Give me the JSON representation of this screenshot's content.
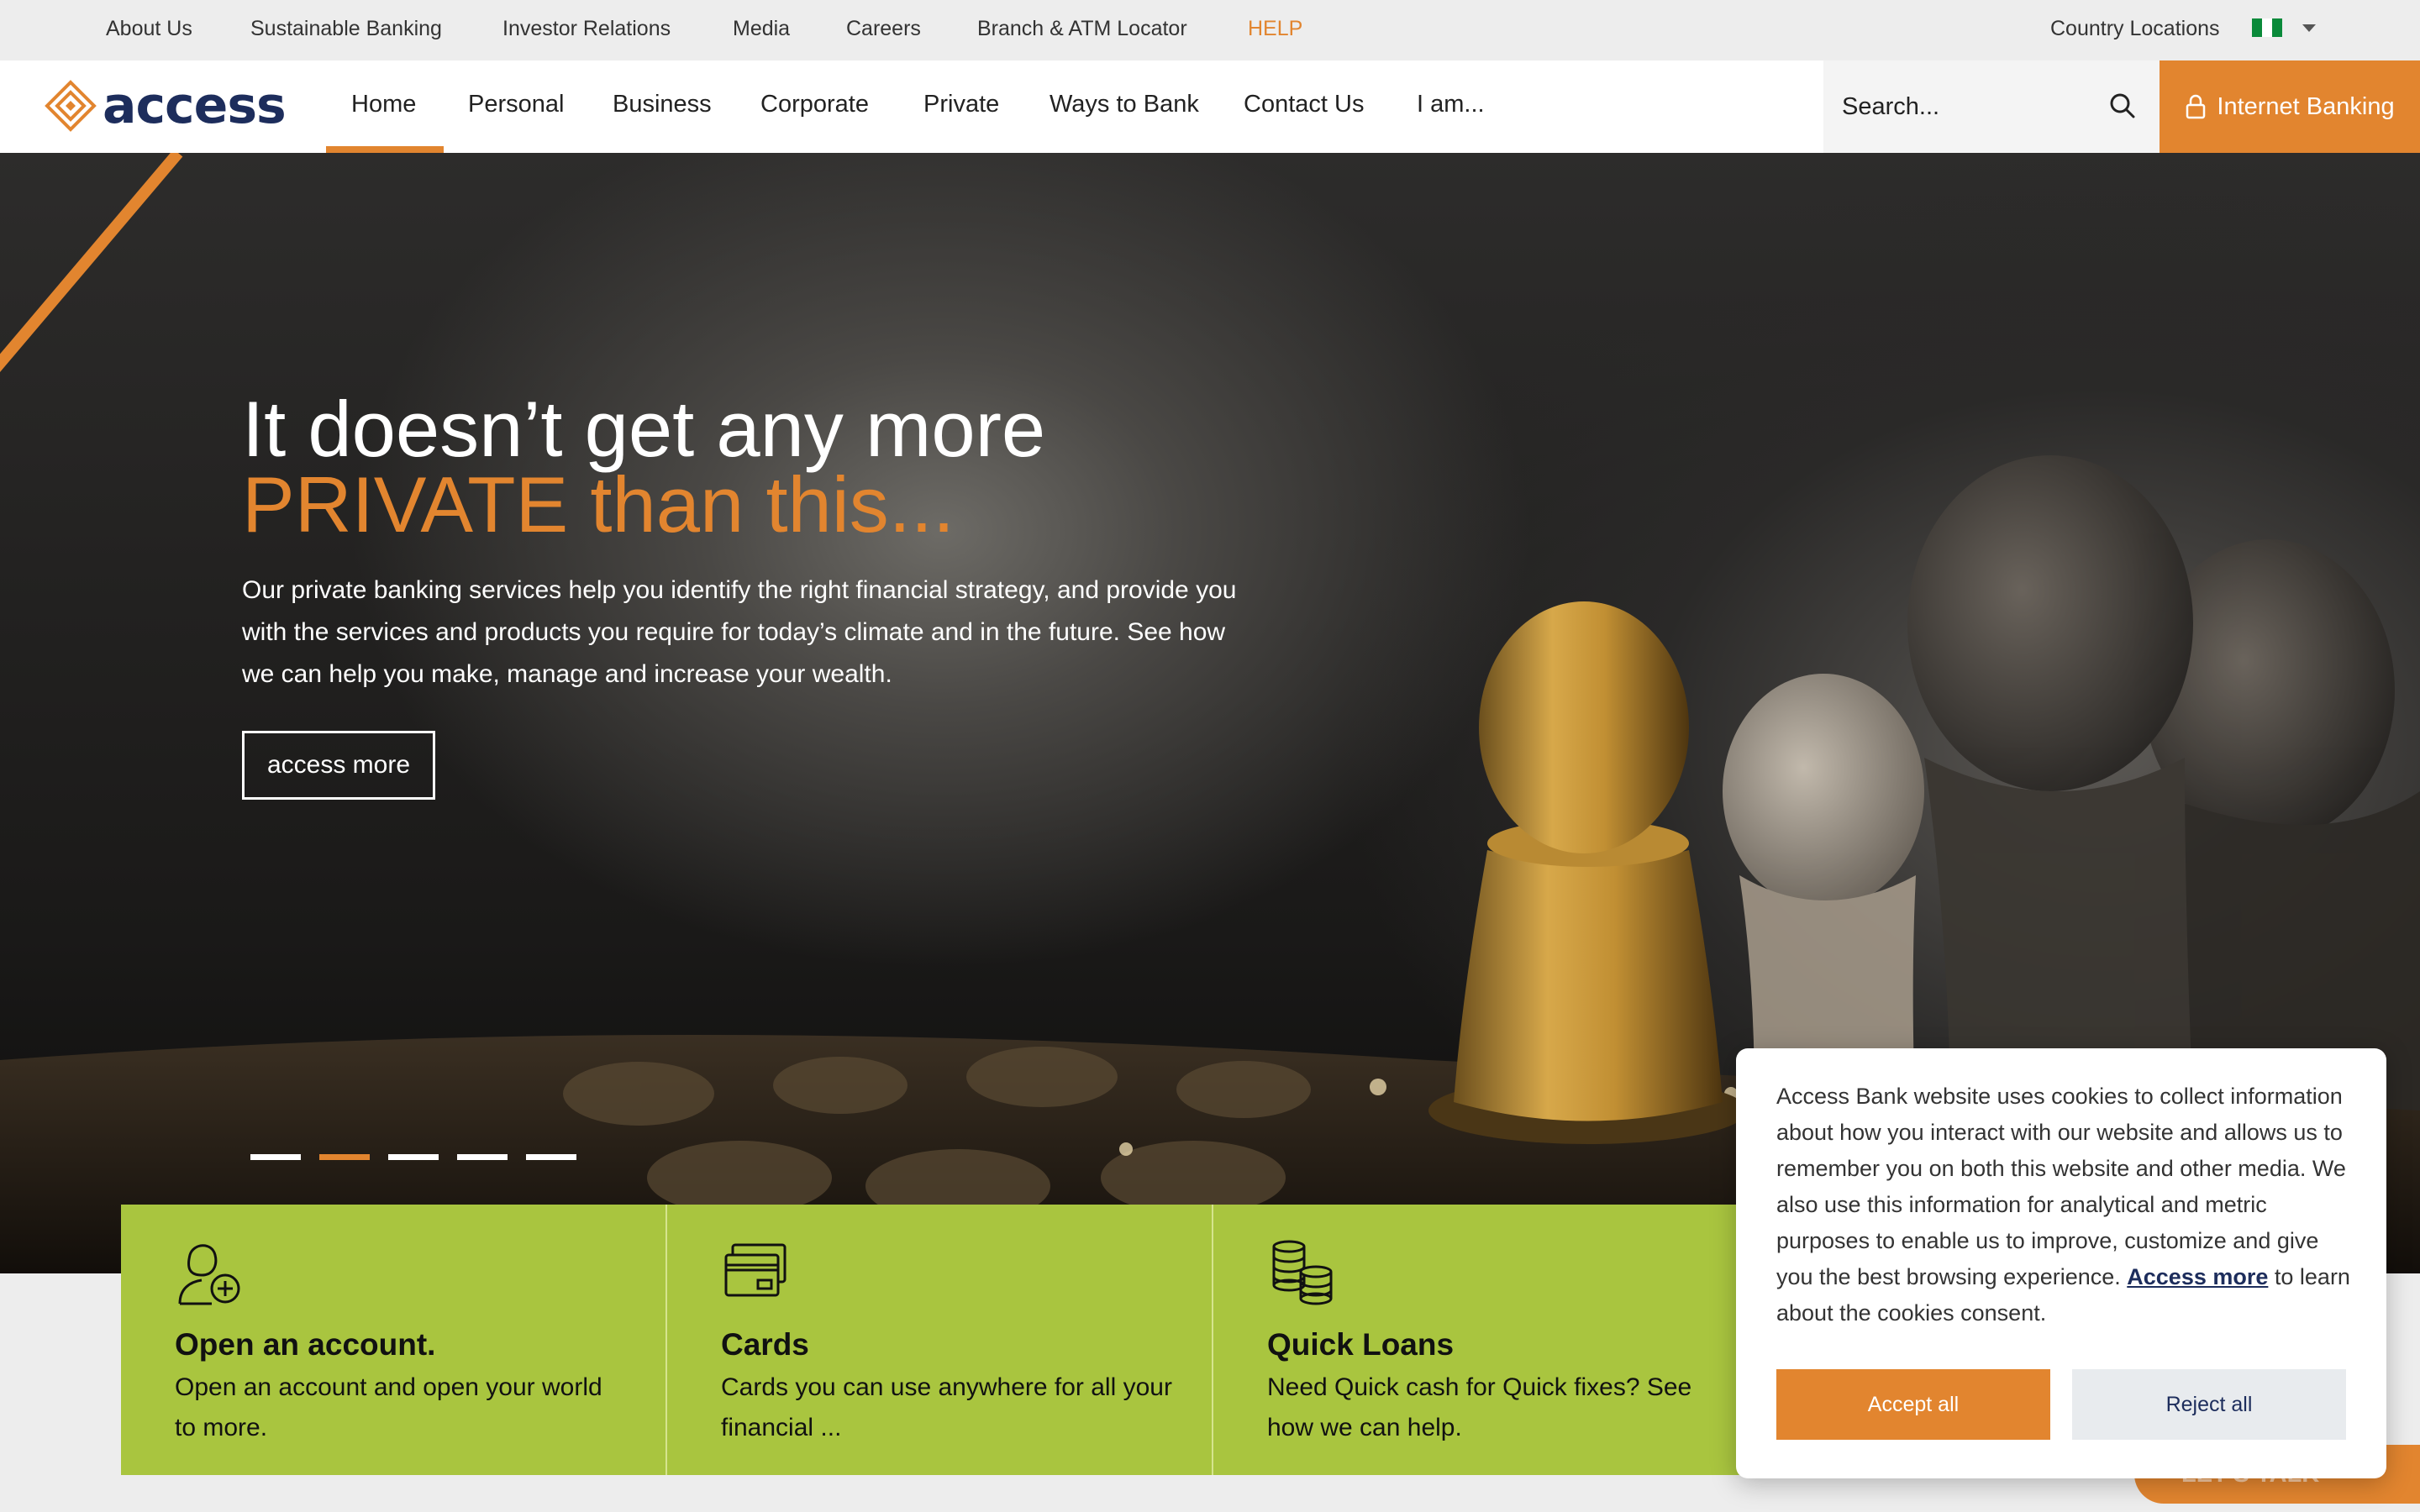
{
  "topbar": {
    "links": [
      "About Us",
      "Sustainable Banking",
      "Investor Relations",
      "Media",
      "Careers",
      "Branch & ATM Locator",
      "HELP"
    ],
    "country_label": "Country Locations"
  },
  "nav": {
    "logo_text": "access",
    "items": [
      "Home",
      "Personal",
      "Business",
      "Corporate",
      "Private",
      "Ways to Bank",
      "Contact Us",
      "I am..."
    ],
    "active_item": "Home",
    "search_placeholder": "Search...",
    "internet_banking_label": "Internet Banking"
  },
  "hero": {
    "title_line1": "It doesn’t get any more",
    "title_line2": "PRIVATE than this...",
    "body": "Our private banking services help you identify the right financial strategy, and provide you with the services and products you require for today’s climate and in the future. See how we can help you make, manage and increase your wealth.",
    "cta_label": "access more",
    "slide_count": 5,
    "active_slide": 2
  },
  "cards": [
    {
      "icon": "user-add-icon",
      "title": "Open an account.",
      "desc": "Open an account and open your world to more."
    },
    {
      "icon": "card-icon",
      "title": "Cards",
      "desc": "Cards you can use anywhere for all your financial ..."
    },
    {
      "icon": "coins-icon",
      "title": "Quick Loans",
      "desc": "Need Quick cash for Quick fixes? See how we can help."
    }
  ],
  "cookie": {
    "text": "Access Bank website uses cookies to collect information about how you interact with our website and allows us to remember you on both this website and other media. We also use this information for analytical and metric purposes to enable us to improve, customize and give you the best browsing experience.",
    "link_label": "Access more",
    "link_suffix": "to learn about the cookies consent.",
    "accept_label": "Accept all",
    "reject_label": "Reject all"
  },
  "lets_talk_label": "LET'S TALK",
  "colors": {
    "brand_orange": "#e2852f",
    "brand_navy": "#1d2d5c",
    "card_green": "#a9c53f"
  }
}
